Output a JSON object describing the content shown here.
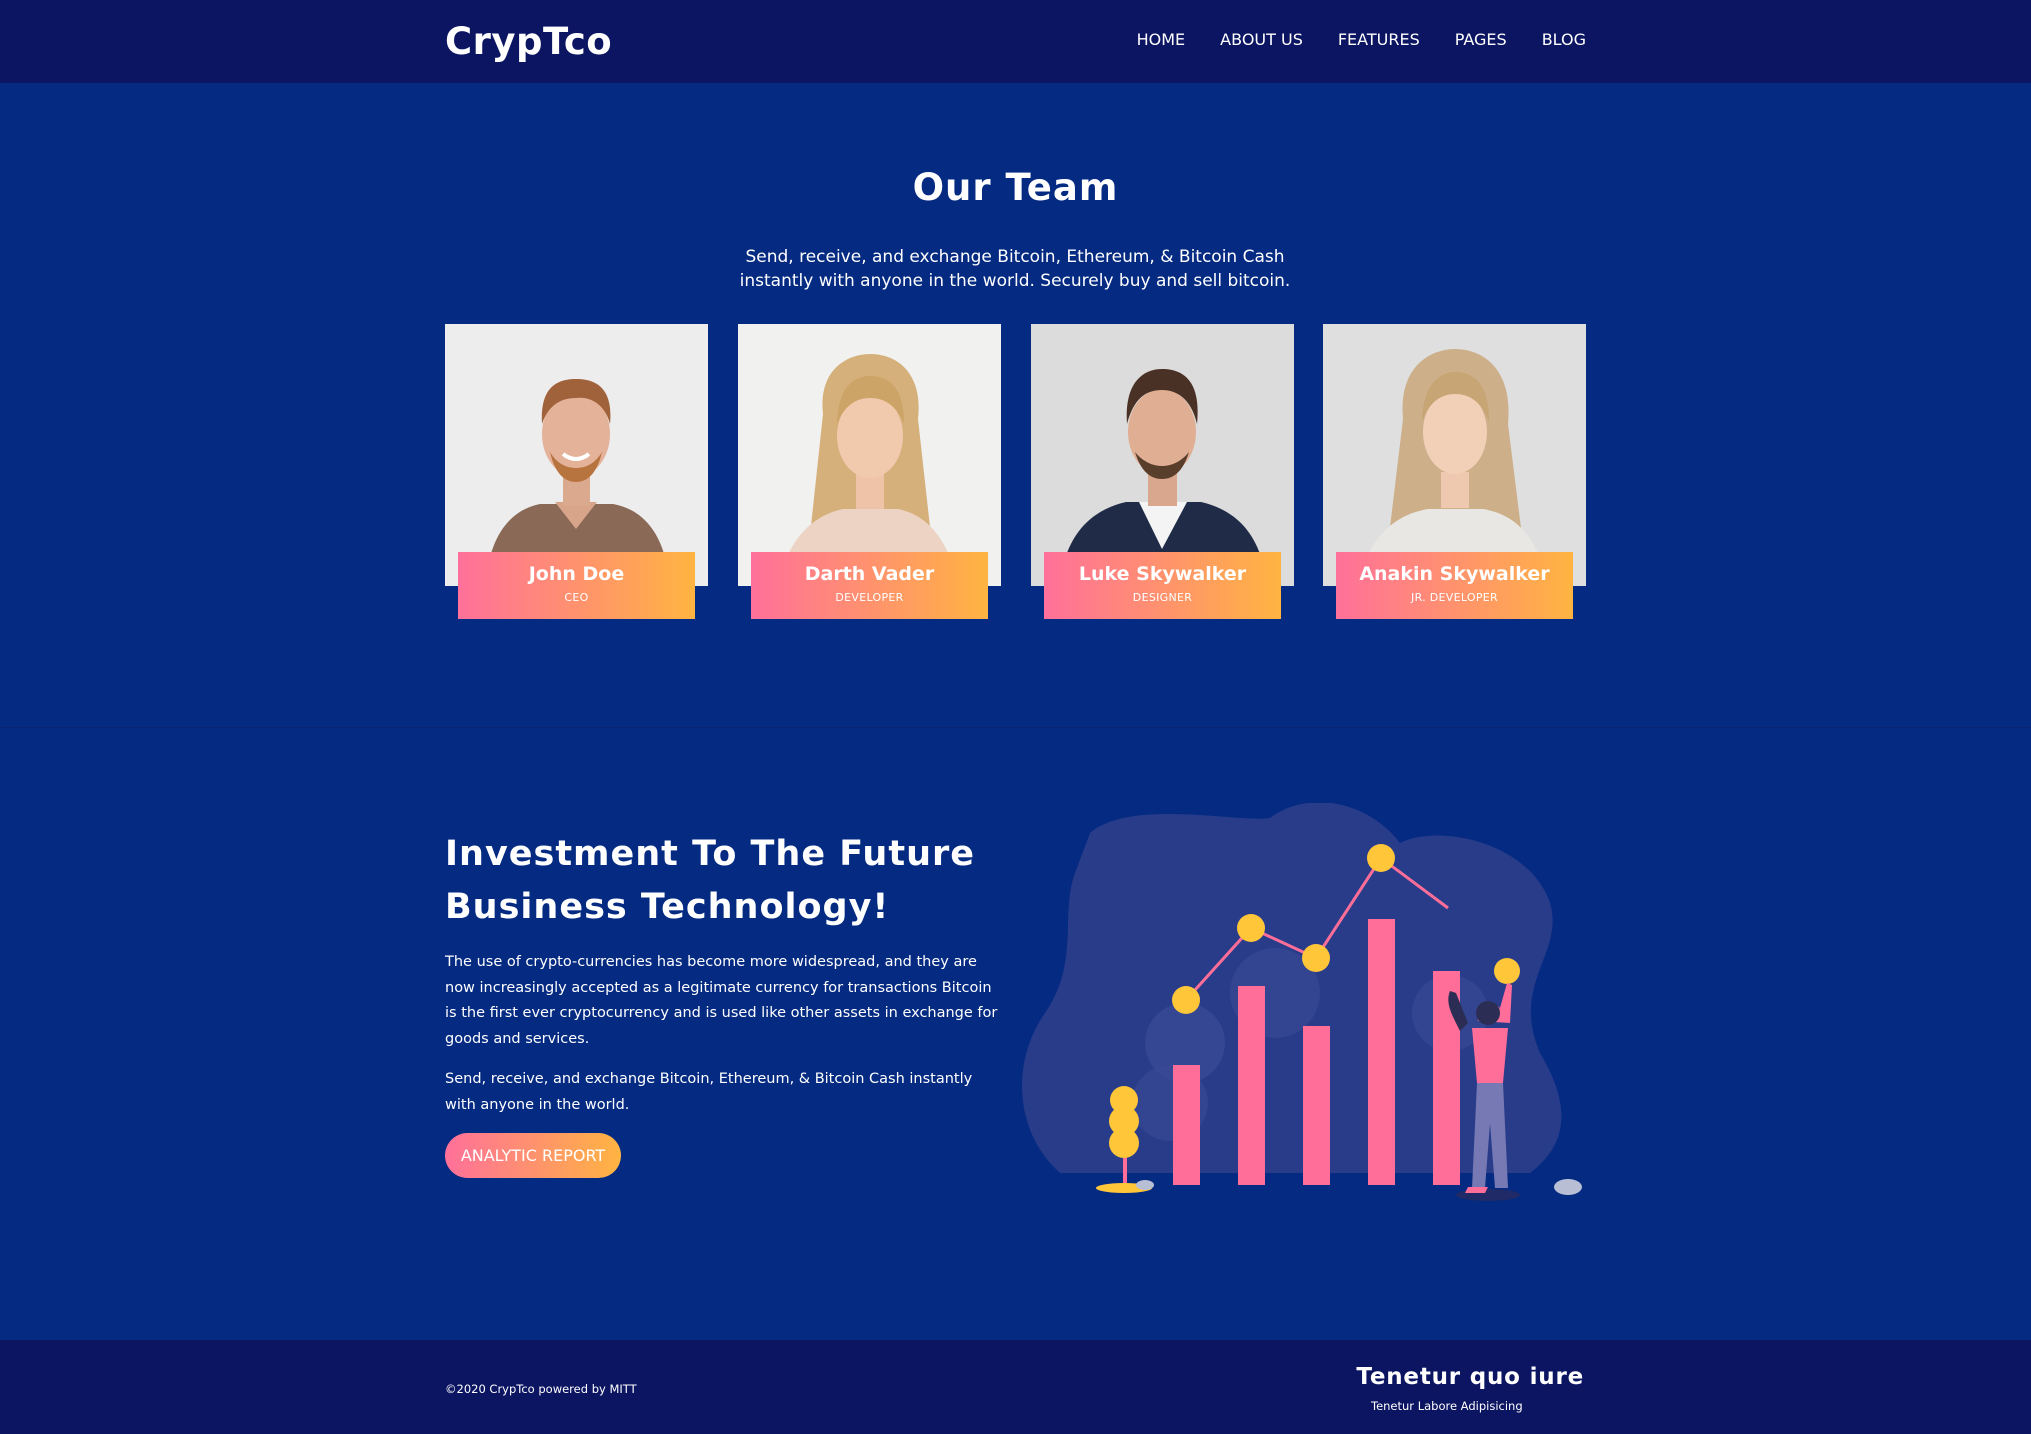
{
  "header": {
    "logo": "CrypTco",
    "nav": [
      "HOME",
      "ABOUT US",
      "FEATURES",
      "PAGES",
      "BLOG"
    ]
  },
  "team": {
    "title": "Our Team",
    "subtitle": "Send, receive, and exchange Bitcoin, Ethereum, & Bitcoin Cash instantly with anyone in the world. Securely buy and sell bitcoin.",
    "members": [
      {
        "name": "John Doe",
        "role": "CEO"
      },
      {
        "name": "Darth Vader",
        "role": "DEVELOPER"
      },
      {
        "name": "Luke Skywalker",
        "role": "DESIGNER"
      },
      {
        "name": "Anakin Skywalker",
        "role": "JR. DEVELOPER"
      }
    ]
  },
  "investment": {
    "title": "Investment To The Future Business Technology!",
    "paragraph1": "The use of crypto-currencies has become more widespread, and they are now increasingly accepted as a legitimate currency for transactions Bitcoin is the first ever cryptocurrency and is used like other assets in exchange for goods and services.",
    "paragraph2": "Send, receive, and exchange Bitcoin, Ethereum, & Bitcoin Cash instantly with anyone in the world.",
    "button_label": "ANALYTIC REPORT"
  },
  "footer": {
    "copyright": "©2020 CrypTco powered by MITT",
    "title": "Tenetur quo iure",
    "subtitle": "Tenetur Labore Adipisicing"
  },
  "colors": {
    "page_bg": "#042a82",
    "header_bg": "#0c1562",
    "gradient_start": "#ff709a",
    "gradient_end": "#ffb441",
    "coin_yellow": "#ffc63a",
    "bar_pink": "#ff6e98"
  }
}
